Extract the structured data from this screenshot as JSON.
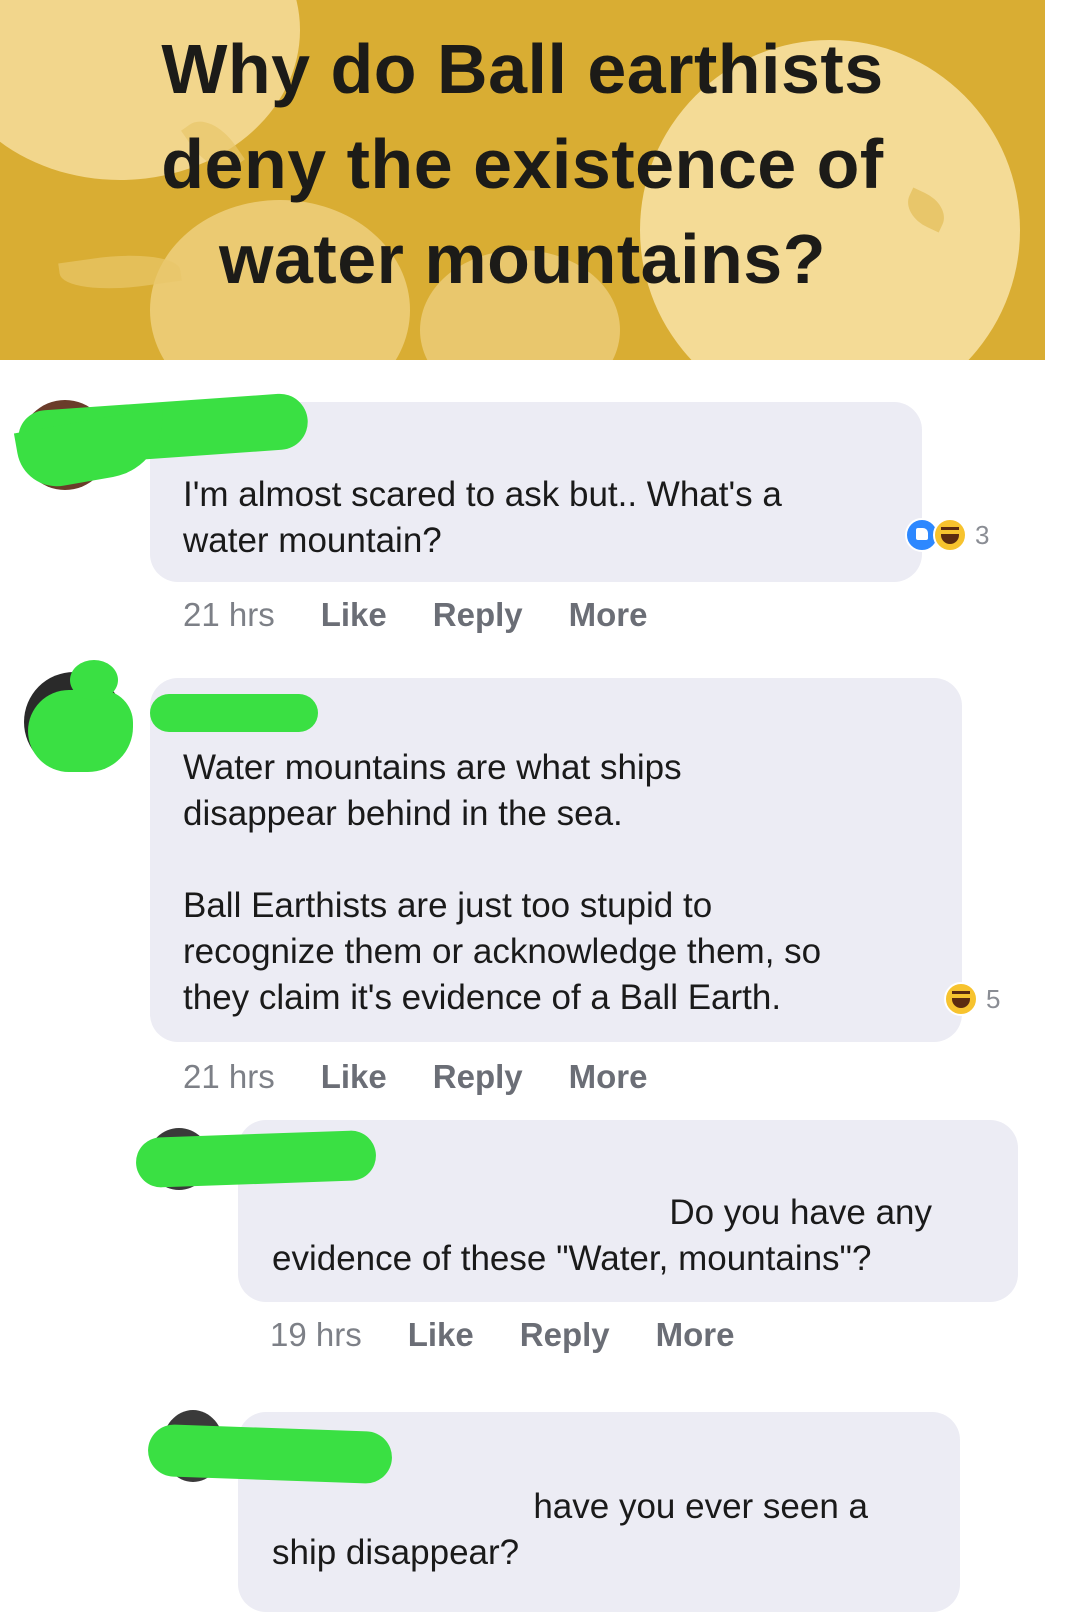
{
  "banner": {
    "title_line1": "Why do Ball earthists",
    "title_line2": "deny the existence of",
    "title_line3": "water mountains?"
  },
  "comments": [
    {
      "lines": [
        "I'm almost scared to ask but.. What's a",
        "water mountain?"
      ],
      "time": "21 hrs",
      "like_label": "Like",
      "reply_label": "Reply",
      "more_label": "More",
      "reactions": {
        "icons": [
          "like-icon",
          "haha-icon"
        ],
        "count": "3"
      }
    },
    {
      "lines": [
        "Water mountains are what ships",
        "disappear behind in the sea.",
        "",
        "Ball Earthists are just too stupid to",
        "recognize them or acknowledge them, so",
        "they claim it's evidence of a Ball Earth."
      ],
      "time": "21 hrs",
      "like_label": "Like",
      "reply_label": "Reply",
      "more_label": "More",
      "reactions": {
        "icons": [
          "haha-icon"
        ],
        "count": "5"
      }
    },
    {
      "lines": [
        "Do you have any",
        "evidence of these \"Water, mountains\"?"
      ],
      "time": "19 hrs",
      "like_label": "Like",
      "reply_label": "Reply",
      "more_label": "More"
    },
    {
      "lines": [
        "have you ever seen a",
        "ship disappear?"
      ]
    }
  ],
  "colors": {
    "banner_bg": "#d9ad33",
    "bubble_bg": "#ececf4",
    "redaction": "#3ae043",
    "like_blue": "#2d88ff",
    "haha_yellow": "#f7c32e"
  }
}
